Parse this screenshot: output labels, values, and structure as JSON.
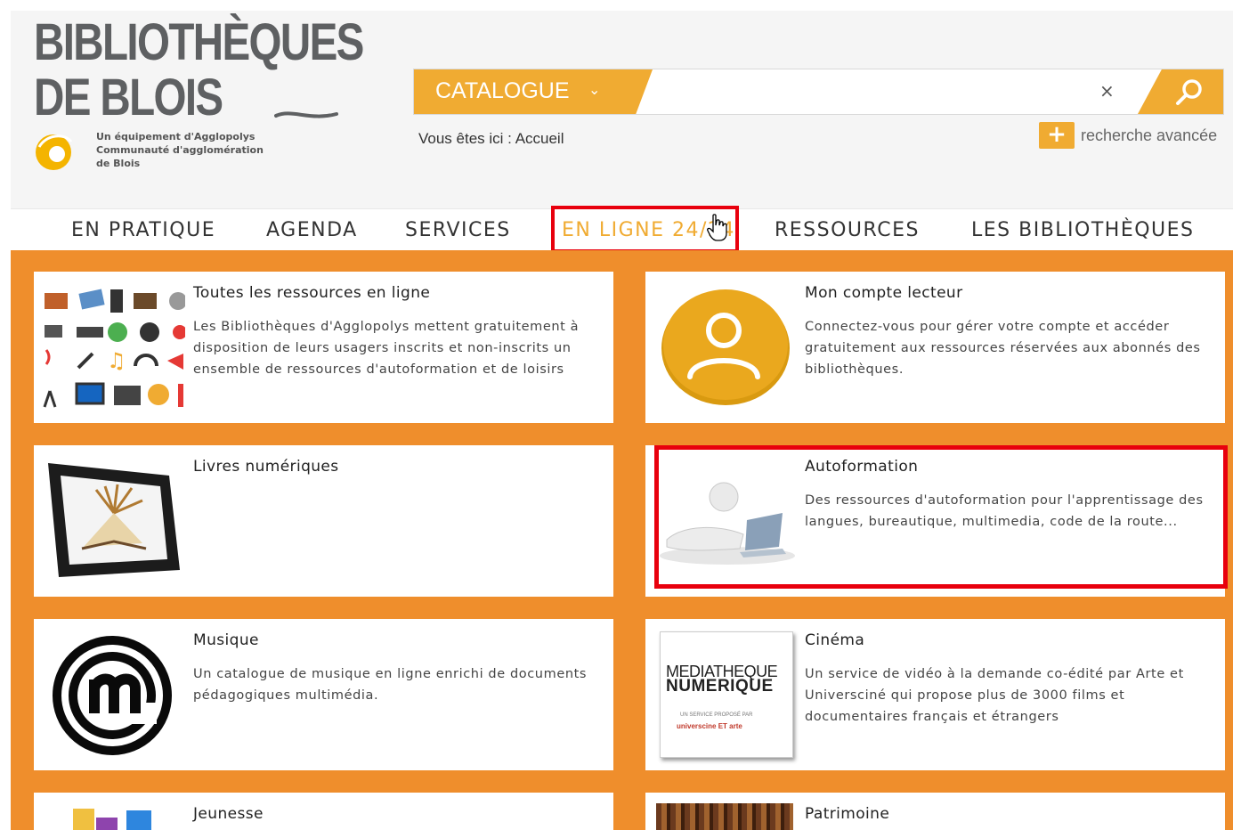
{
  "logo": {
    "line1": "BIBLIOTHÈQUES",
    "line2": "DE BLOIS",
    "subtitle_lines": [
      "Un équipement d'Agglopolys",
      "Communauté d'agglomération",
      "de Blois"
    ]
  },
  "search": {
    "scope_label": "CATALOGUE",
    "scope_chevron": "⌄",
    "input_value": "",
    "clear_glyph": "×"
  },
  "breadcrumb": {
    "prefix": "Vous êtes ici :",
    "current": "Accueil"
  },
  "advanced_search": {
    "plus": "+",
    "label": "recherche avancée"
  },
  "nav": {
    "items": [
      "EN PRATIQUE",
      "AGENDA",
      "SERVICES",
      "EN LIGNE 24/24",
      "RESSOURCES",
      "LES BIBLIOTHÈQUES"
    ],
    "active": "EN LIGNE 24/24"
  },
  "cards": [
    {
      "title": "Toutes les ressources en ligne",
      "desc_lines": [
        "Les Bibliothèques d'Agglopolys mettent gratuitement à",
        "disposition de leurs usagers inscrits et non-inscrits un",
        "ensemble de ressources d'autoformation et de loisirs"
      ],
      "icon": "media-icons-grid-icon"
    },
    {
      "title": "Mon compte lecteur",
      "desc_lines": [
        "Connectez-vous pour gérer votre compte et accéder",
        "gratuitement aux ressources réservées aux abonnés des",
        "bibliothèques."
      ],
      "icon": "user-account-icon"
    },
    {
      "title": "Livres numériques",
      "desc_lines": [],
      "icon": "tablet-book-icon"
    },
    {
      "title": "Autoformation",
      "desc_lines": [
        "Des ressources d'autoformation pour l'apprentissage des",
        "langues, bureautique, multimedia, code de la route..."
      ],
      "icon": "person-laptop-icon"
    },
    {
      "title": "Musique",
      "desc_lines": [
        "Un catalogue de musique en ligne enrichi de documents",
        "pédagogiques multimédia."
      ],
      "icon": "music-logo-icon"
    },
    {
      "title": "Cinéma",
      "desc_lines": [
        "Un service de vidéo à la demande co-édité par Arte et",
        "Universciné qui propose plus de 3000 films et",
        "documentaires français et étrangers"
      ],
      "icon": "mediatheque-numerique-icon"
    },
    {
      "title": "Jeunesse",
      "desc_lines": [],
      "icon": "toy-blocks-icon"
    },
    {
      "title": "Patrimoine",
      "desc_lines": [],
      "icon": "library-shelves-icon"
    }
  ],
  "thumb_text": {
    "mediatheque_line1": "MEDIATHEQUE",
    "mediatheque_line2": "NUMERIQUE",
    "mediatheque_line3": "UN SERVICE PROPOSÉ PAR",
    "mediatheque_line4": "universcine ET arte"
  },
  "colors": {
    "brand_orange": "#f0ab32",
    "background_orange": "#ef8e2c",
    "highlight_red": "#e8000d"
  }
}
